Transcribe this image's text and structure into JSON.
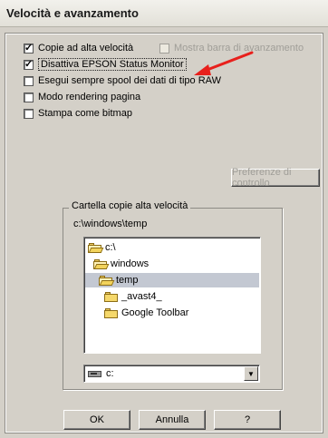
{
  "window": {
    "title": "Velocità e avanzamento"
  },
  "options": [
    {
      "label": "Copie ad alta velocità",
      "checked": true
    },
    {
      "label": "Mostra barra di avanzamento",
      "checked": false,
      "disabled": true
    },
    {
      "label": "Disattiva EPSON Status Monitor",
      "checked": true
    },
    {
      "label": "Esegui sempre spool dei dati di tipo RAW",
      "checked": false
    },
    {
      "label": "Modo rendering pagina",
      "checked": false
    },
    {
      "label": "Stampa come bitmap",
      "checked": false
    }
  ],
  "buttons": {
    "preferences": "Preferenze di controllo",
    "ok": "OK",
    "cancel": "Annulla",
    "help": "?"
  },
  "group": {
    "title": "Cartella copie alta velocità",
    "path": "c:\\windows\\temp",
    "folders": [
      {
        "name": "c:\\",
        "icon": "open-folder-icon"
      },
      {
        "name": "windows",
        "icon": "open-folder-icon"
      },
      {
        "name": "temp",
        "icon": "open-folder-icon",
        "selected": true
      },
      {
        "name": "_avast4_",
        "icon": "folder-icon"
      },
      {
        "name": "Google Toolbar",
        "icon": "folder-icon"
      }
    ],
    "drive": "c:"
  },
  "colors": {
    "arrow": "#e8201c",
    "selection": "#c3c8d2"
  }
}
